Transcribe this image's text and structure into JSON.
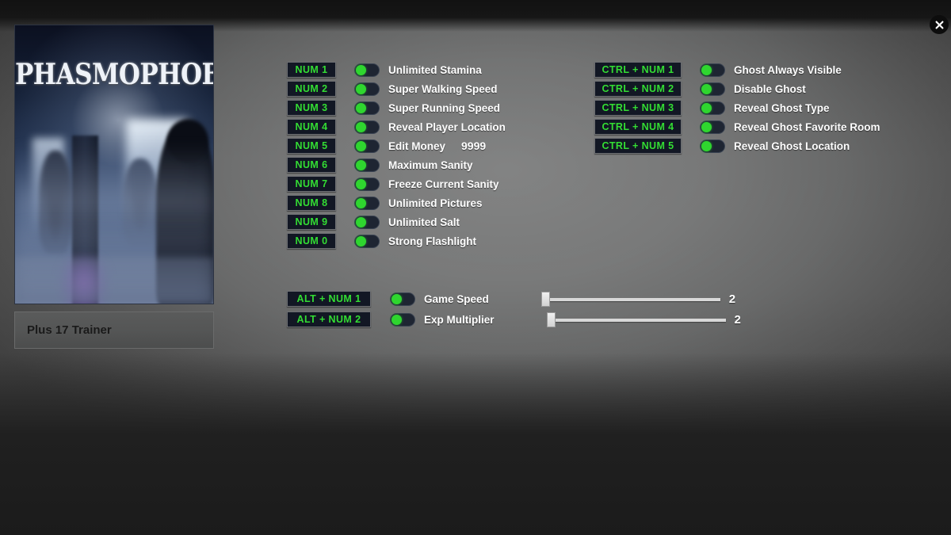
{
  "window": {
    "close_icon": "close-icon"
  },
  "cover": {
    "game_title": "PHASMOPHOBIA",
    "trainer_name": "Plus 17 Trainer"
  },
  "colors": {
    "hotkey_text": "#33dd33",
    "hotkey_bg": "#121724",
    "toggle_knob": "#2fd62f",
    "label_text": "#ffffff",
    "panel_bg": "#5d5e5e"
  },
  "options_left": [
    {
      "hotkey": "NUM 1",
      "label": "Unlimited Stamina",
      "enabled": false,
      "value": null
    },
    {
      "hotkey": "NUM 2",
      "label": "Super Walking Speed",
      "enabled": false,
      "value": null
    },
    {
      "hotkey": "NUM 3",
      "label": "Super Running Speed",
      "enabled": false,
      "value": null
    },
    {
      "hotkey": "NUM 4",
      "label": "Reveal Player Location",
      "enabled": false,
      "value": null
    },
    {
      "hotkey": "NUM 5",
      "label": "Edit Money",
      "enabled": false,
      "value": "9999"
    },
    {
      "hotkey": "NUM 6",
      "label": "Maximum Sanity",
      "enabled": false,
      "value": null
    },
    {
      "hotkey": "NUM 7",
      "label": "Freeze Current Sanity",
      "enabled": false,
      "value": null
    },
    {
      "hotkey": "NUM 8",
      "label": "Unlimited Pictures",
      "enabled": false,
      "value": null
    },
    {
      "hotkey": "NUM 9",
      "label": "Unlimited Salt",
      "enabled": false,
      "value": null
    },
    {
      "hotkey": "NUM 0",
      "label": "Strong Flashlight",
      "enabled": false,
      "value": null
    }
  ],
  "options_right": [
    {
      "hotkey": "CTRL + NUM 1",
      "label": "Ghost Always Visible",
      "enabled": false
    },
    {
      "hotkey": "CTRL + NUM 2",
      "label": "Disable Ghost",
      "enabled": false
    },
    {
      "hotkey": "CTRL + NUM 3",
      "label": "Reveal Ghost Type",
      "enabled": false
    },
    {
      "hotkey": "CTRL + NUM 4",
      "label": "Reveal Ghost Favorite Room",
      "enabled": false
    },
    {
      "hotkey": "CTRL + NUM 5",
      "label": "Reveal Ghost Location",
      "enabled": false
    }
  ],
  "sliders": [
    {
      "hotkey": "ALT + NUM 1",
      "label": "Game Speed",
      "enabled": false,
      "value": "2",
      "percent": 0
    },
    {
      "hotkey": "ALT + NUM 2",
      "label": "Exp Multiplier",
      "enabled": false,
      "value": "2",
      "percent": 0
    }
  ]
}
